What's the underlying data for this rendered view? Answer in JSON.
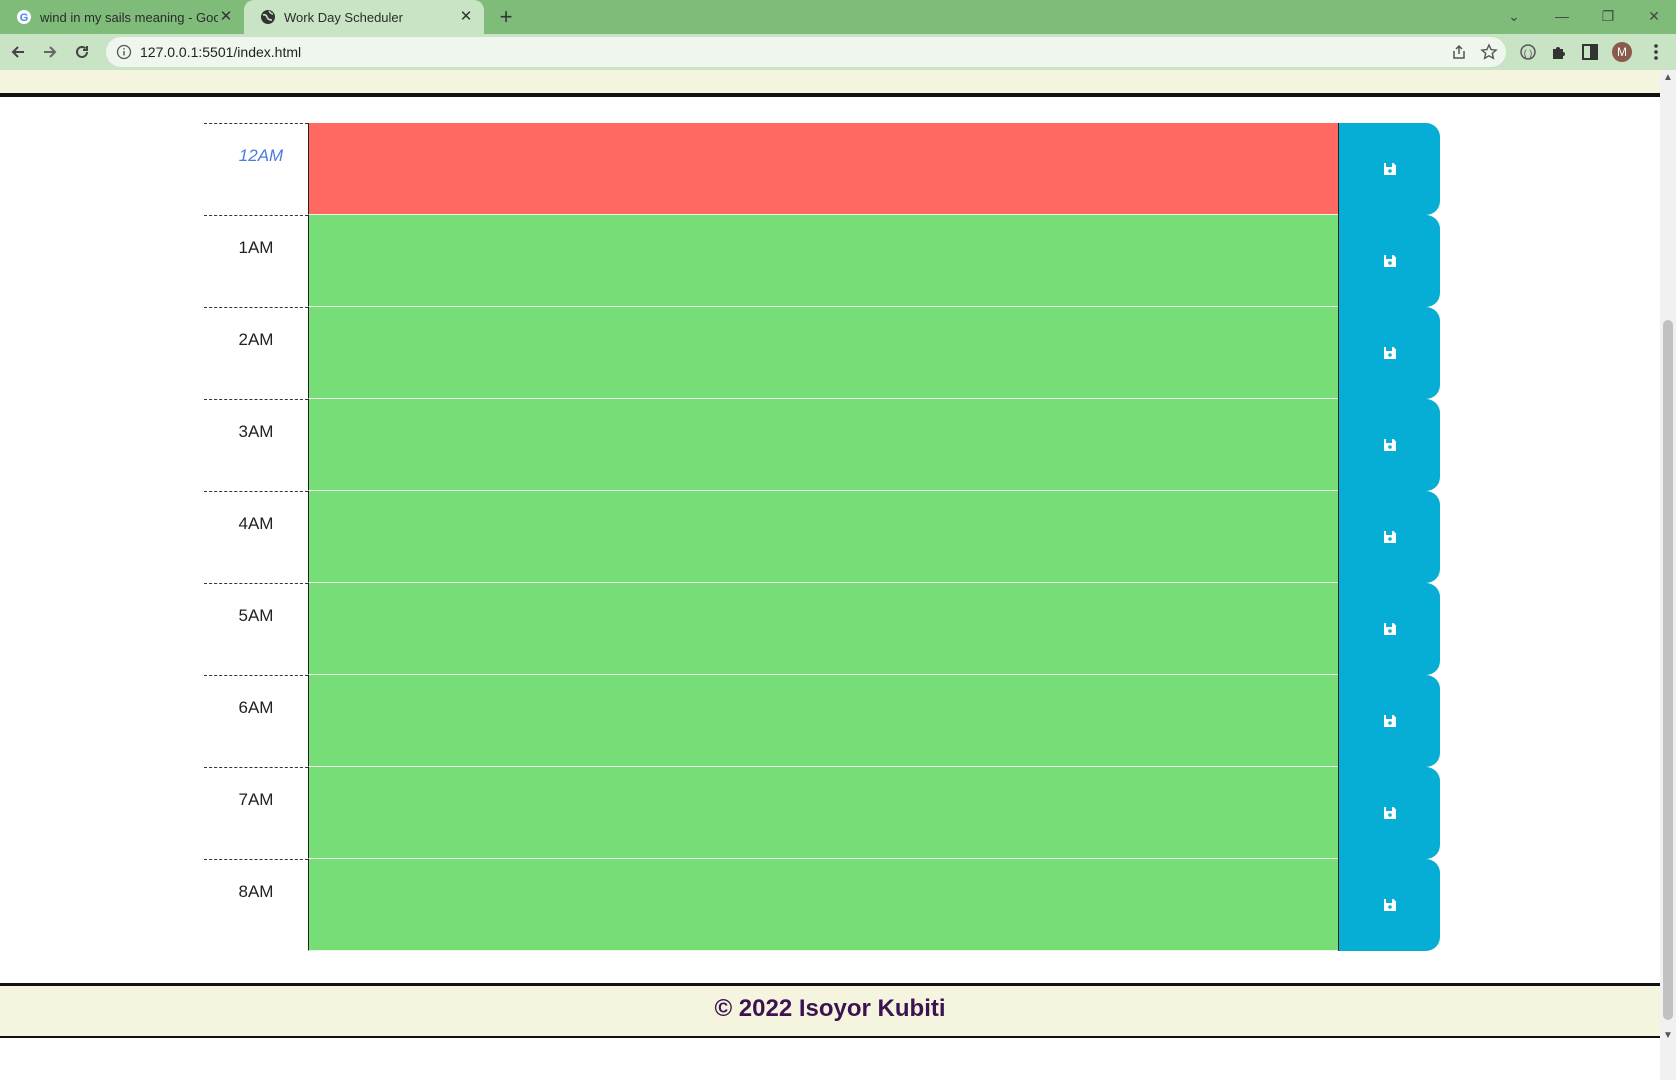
{
  "browser": {
    "tabs": [
      {
        "title": "wind in my sails meaning - Goog",
        "icon": "google-icon",
        "active": false
      },
      {
        "title": "Work Day Scheduler",
        "icon": "globe-icon",
        "active": true
      }
    ],
    "new_tab_label": "+",
    "url": "127.0.0.1:5501/index.html",
    "profile_initial": "M"
  },
  "schedule": {
    "rows": [
      {
        "hour": "12AM",
        "state": "present",
        "text": ""
      },
      {
        "hour": "1AM",
        "state": "future",
        "text": ""
      },
      {
        "hour": "2AM",
        "state": "future",
        "text": ""
      },
      {
        "hour": "3AM",
        "state": "future",
        "text": ""
      },
      {
        "hour": "4AM",
        "state": "future",
        "text": ""
      },
      {
        "hour": "5AM",
        "state": "future",
        "text": ""
      },
      {
        "hour": "6AM",
        "state": "future",
        "text": ""
      },
      {
        "hour": "7AM",
        "state": "future",
        "text": ""
      },
      {
        "hour": "8AM",
        "state": "future",
        "text": ""
      }
    ],
    "save_icon": "floppy-disk-icon"
  },
  "footer": {
    "text": "© 2022 Isoyor Kubiti"
  },
  "colors": {
    "present": "#ff6961",
    "future": "#77dd77",
    "save": "#06aed5",
    "chrome": "#7fbc7a",
    "footer_text": "#3a1450"
  }
}
